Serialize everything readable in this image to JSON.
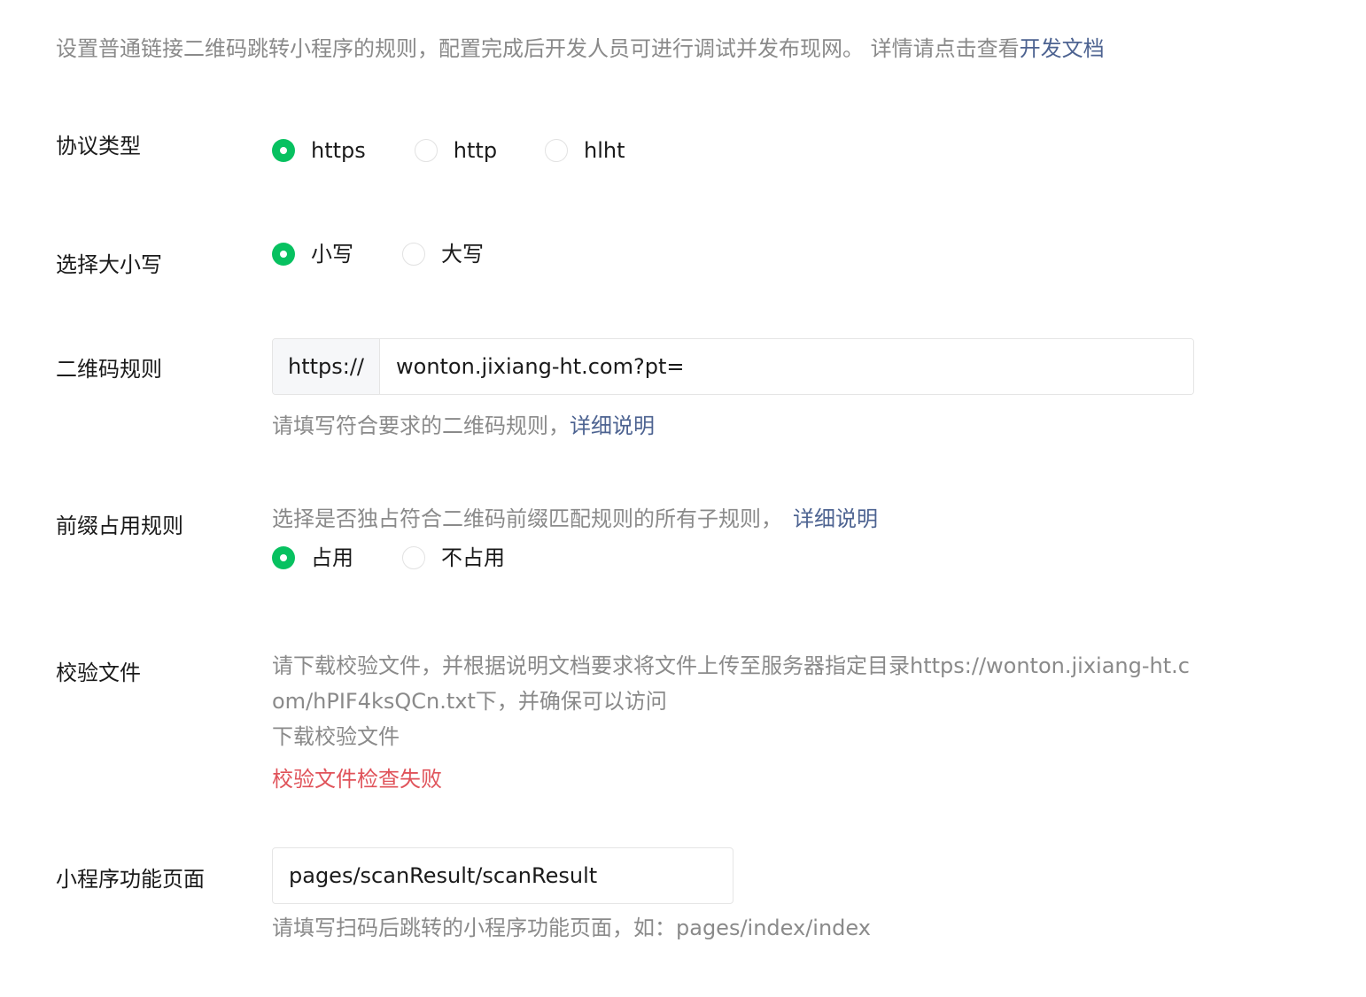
{
  "intro": {
    "text": "设置普通链接二维码跳转小程序的规则，配置完成后开发人员可进行调试并发布现网。 详情请点击查看",
    "link": "开发文档"
  },
  "protocol": {
    "label": "协议类型",
    "options": [
      "https",
      "http",
      "hlht"
    ],
    "selected": "https"
  },
  "case": {
    "label": "选择大小写",
    "options": [
      "小写",
      "大写"
    ],
    "selected": "小写"
  },
  "qr_rule": {
    "label": "二维码规则",
    "prefix": "https://",
    "value": "wonton.jixiang-ht.com?pt=",
    "hint": "请填写符合要求的二维码规则，",
    "hint_link": "详细说明"
  },
  "prefix_rule": {
    "label": "前缀占用规则",
    "hint": "选择是否独占符合二维码前缀匹配规则的所有子规则，",
    "hint_link": "详细说明",
    "options": [
      "占用",
      "不占用"
    ],
    "selected": "占用"
  },
  "verify_file": {
    "label": "校验文件",
    "desc": "请下载校验文件，并根据说明文档要求将文件上传至服务器指定目录https://wonton.jixiang-ht.com/hPIF4ksQCn.txt下，并确保可以访问",
    "download_link": "下载校验文件",
    "error": "校验文件检查失败"
  },
  "mini_page": {
    "label": "小程序功能页面",
    "value": "pages/scanResult/scanResult",
    "hint": "请填写扫码后跳转的小程序功能页面，如：pages/index/index"
  },
  "colors": {
    "accent": "#07c160",
    "link": "#4d6391",
    "error": "#e0535a",
    "muted": "#8a8a8a"
  }
}
